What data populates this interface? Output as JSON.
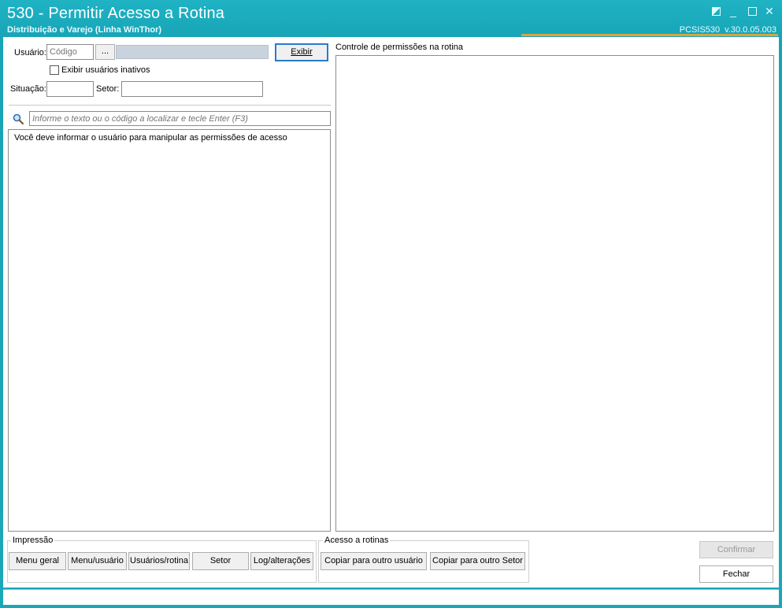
{
  "window": {
    "title": "530 - Permitir Acesso a Rotina",
    "subtitle": "Distribuição e Varejo (Linha WinThor)",
    "routine_code": "PCSIS530",
    "version": "v.30.0.05.003"
  },
  "filters": {
    "usuario_label": "Usuário:",
    "usuario_code_placeholder": "Código",
    "lookup_button": "...",
    "usuario_name_value": "",
    "exibir_button": "Exibir",
    "inativos_label": "Exibir usuários inativos",
    "situacao_label": "Situação:",
    "situacao_value": "",
    "setor_label": "Setor:",
    "setor_value": ""
  },
  "search": {
    "placeholder": "Informe o texto ou o código a localizar e tecle Enter (F3)",
    "icon": "search-icon"
  },
  "left_panel": {
    "message": "Você deve informar o usuário para manipular as permissões de acesso"
  },
  "right_panel": {
    "title": "Controle de permissões na rotina"
  },
  "impressao": {
    "title": "Impressão",
    "buttons": [
      "Menu geral",
      "Menu/usuário",
      "Usuários/rotina",
      "Setor",
      "Log/alterações"
    ]
  },
  "acesso": {
    "title": "Acesso a rotinas",
    "buttons": [
      "Copiar para outro usuário",
      "Copiar para outro Setor"
    ]
  },
  "actions": {
    "confirmar": "Confirmar",
    "fechar": "Fechar"
  },
  "theme": {
    "title_bg": "#1aa7b8",
    "accent": "#d9a441",
    "focus": "#2a7ac9"
  }
}
